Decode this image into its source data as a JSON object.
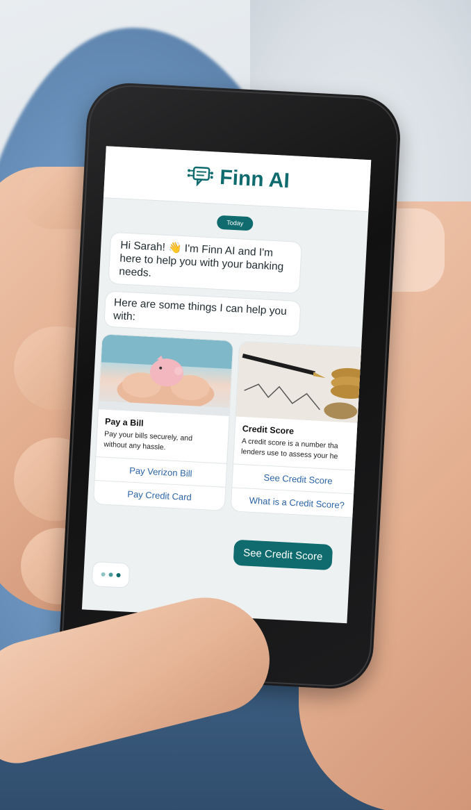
{
  "app": {
    "brand": "Finn AI"
  },
  "chat": {
    "date_label": "Today",
    "messages": [
      "Hi Sarah! 👋 I'm Finn AI and I'm here to help you with your banking needs.",
      "Here are some things I can help you with:"
    ],
    "cards": [
      {
        "title": "Pay a Bill",
        "description_lines": [
          "Pay your bills securely, and",
          "without any hassle."
        ],
        "image": "piggy-bank-photo",
        "buttons": [
          "Pay Verizon Bill",
          "Pay Credit Card"
        ]
      },
      {
        "title": "Credit Score",
        "description_lines": [
          "A credit score is a number tha",
          "lenders use to assess your he"
        ],
        "image": "credit-report-coins-photo",
        "buttons": [
          "See Credit Score",
          "What is a Credit Score?"
        ]
      }
    ],
    "reply": "See Credit Score"
  },
  "colors": {
    "brand_teal": "#0f6b6d",
    "link_blue": "#2c63a6",
    "screen_bg": "#eef1f2"
  }
}
